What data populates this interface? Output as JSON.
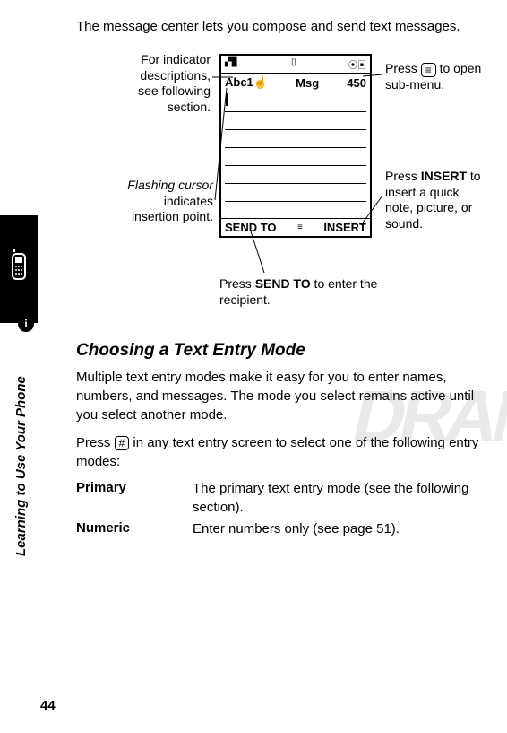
{
  "intro": "The message center lets you compose and send text messages.",
  "callouts": {
    "indicator": "For indicator descriptions, see following section.",
    "cursor_a": "Flashing cursor",
    "cursor_b": "indicates insertion point.",
    "submenu_a": "Press ",
    "submenu_key": "≡",
    "submenu_b": " to open sub-menu.",
    "insert_a": "Press ",
    "insert_key": "INSERT",
    "insert_b": " to insert a quick note, picture, or sound.",
    "sendto_a": "Press ",
    "sendto_key": "SEND TO",
    "sendto_b": " to enter the recipient."
  },
  "phone": {
    "status_left": "▞▊",
    "status_mid": "▯",
    "status_right": "⦿▣",
    "indicator_prefix": "Abc1☝",
    "title": "Msg",
    "count": "450",
    "soft_left": "SEND TO",
    "soft_mid": "≡",
    "soft_right": "INSERT"
  },
  "section_title": "Choosing a Text Entry Mode",
  "para1": "Multiple text entry modes make it easy for you to enter names, numbers, and messages. The mode you select remains active until you select another mode.",
  "para2_a": "Press ",
  "para2_key": "#",
  "para2_b": " in any text entry screen to select one of the following entry modes:",
  "modes": {
    "primary_name": "Primary",
    "primary_desc": "The primary text entry mode (see the following section).",
    "numeric_name": "Numeric",
    "numeric_desc": "Enter numbers only (see page 51)."
  },
  "side_title": "Learning to Use Your Phone",
  "page_no": "44",
  "info_badge": "i"
}
